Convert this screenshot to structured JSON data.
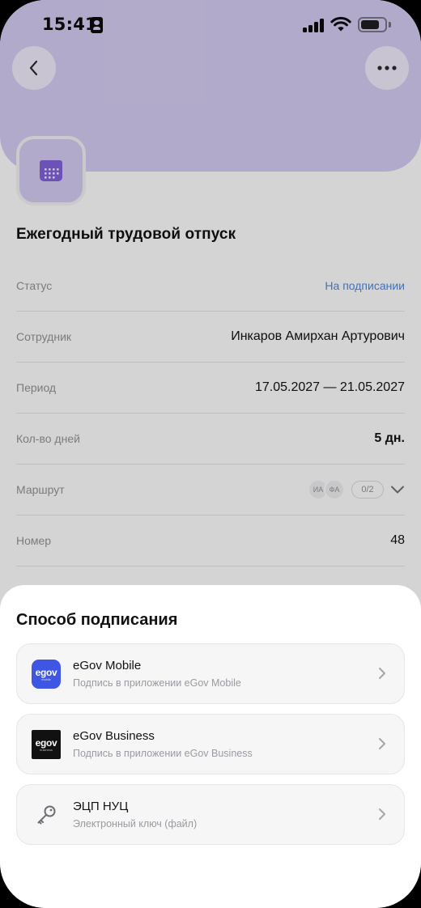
{
  "status_bar": {
    "time": "15:41"
  },
  "document": {
    "title": "Ежегодный трудовой отпуск",
    "fields": [
      {
        "label": "Статус",
        "value": "На подписании"
      },
      {
        "label": "Сотрудник",
        "value": "Инкаров Амирхан Артурович"
      },
      {
        "label": "Период",
        "value": "17.05.2027 — 21.05.2027"
      },
      {
        "label": "Кол-во дней",
        "value": "5 дн."
      },
      {
        "label": "Маршрут",
        "avatars": [
          "ИА",
          "ФА"
        ],
        "count": "0/2"
      },
      {
        "label": "Номер",
        "value": "48"
      }
    ]
  },
  "sheet": {
    "title": "Способ подписания",
    "options": [
      {
        "title": "eGov Mobile",
        "subtitle": "Подпись в приложении eGov Mobile",
        "logo_text": "egov",
        "logo_sub": "mobile"
      },
      {
        "title": "eGov Business",
        "subtitle": "Подпись в приложении eGov Business",
        "logo_text": "egov",
        "logo_sub": "business"
      },
      {
        "title": "ЭЦП НУЦ",
        "subtitle": "Электронный ключ (файл)"
      }
    ]
  },
  "colors": {
    "header": "#cdc4e8",
    "accent_purple": "#7c5fd3",
    "link_blue": "#4a84d8",
    "egov_blue": "#3e56e3"
  },
  "icons": {
    "back": "chevron-left-icon",
    "more": "more-horizontal-icon",
    "document": "calendar-icon",
    "route_toggle": "chevron-down-icon",
    "option": "chevron-right-icon",
    "nuc": "key-icon"
  }
}
